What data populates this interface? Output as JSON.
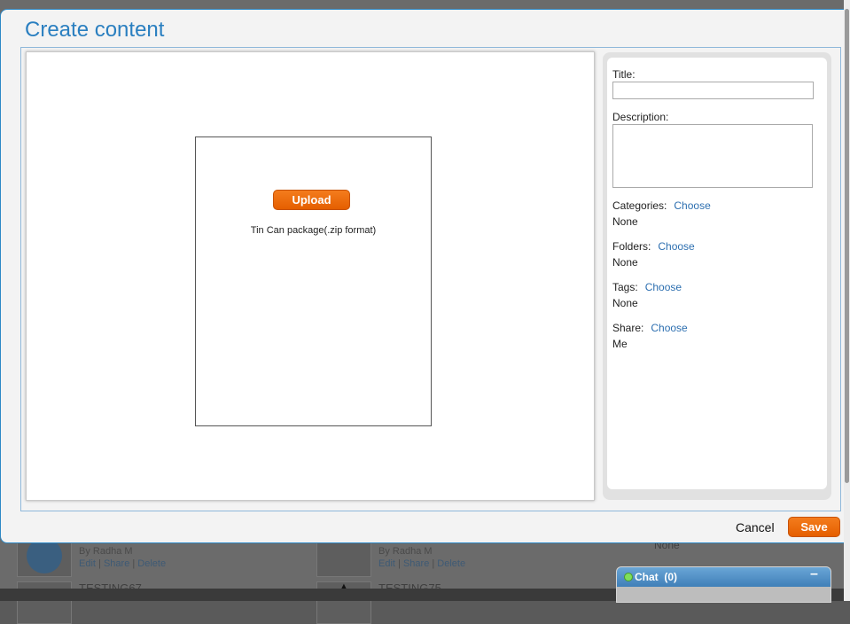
{
  "background": {
    "row1": {
      "left_author": "By Radha M",
      "left_actions": [
        "Edit",
        "Share",
        "Delete"
      ],
      "right_author": "By Radha M",
      "right_actions": [
        "Edit",
        "Share",
        "Delete"
      ],
      "none_label": "None"
    },
    "row2": {
      "left_title": "TESTING67",
      "right_title": "TESTING75"
    }
  },
  "modal": {
    "title": "Create content",
    "upload": {
      "button_label": "Upload",
      "hint": "Tin Can package(.zip format)"
    },
    "sidebar": {
      "title_label": "Title:",
      "title_value": "",
      "description_label": "Description:",
      "description_value": "",
      "categories": {
        "label": "Categories:",
        "choose": "Choose",
        "value": "None"
      },
      "folders": {
        "label": "Folders:",
        "choose": "Choose",
        "value": "None"
      },
      "tags": {
        "label": "Tags:",
        "choose": "Choose",
        "value": "None"
      },
      "share": {
        "label": "Share:",
        "choose": "Choose",
        "value": "Me"
      }
    },
    "footer": {
      "cancel_label": "Cancel",
      "save_label": "Save"
    }
  },
  "chat": {
    "label": "Chat",
    "count": "(0)",
    "minimize_icon": "minus-icon",
    "status_color": "#7fe05a"
  },
  "colors": {
    "accent": "#2a7fc0",
    "button": "#f06f12"
  }
}
